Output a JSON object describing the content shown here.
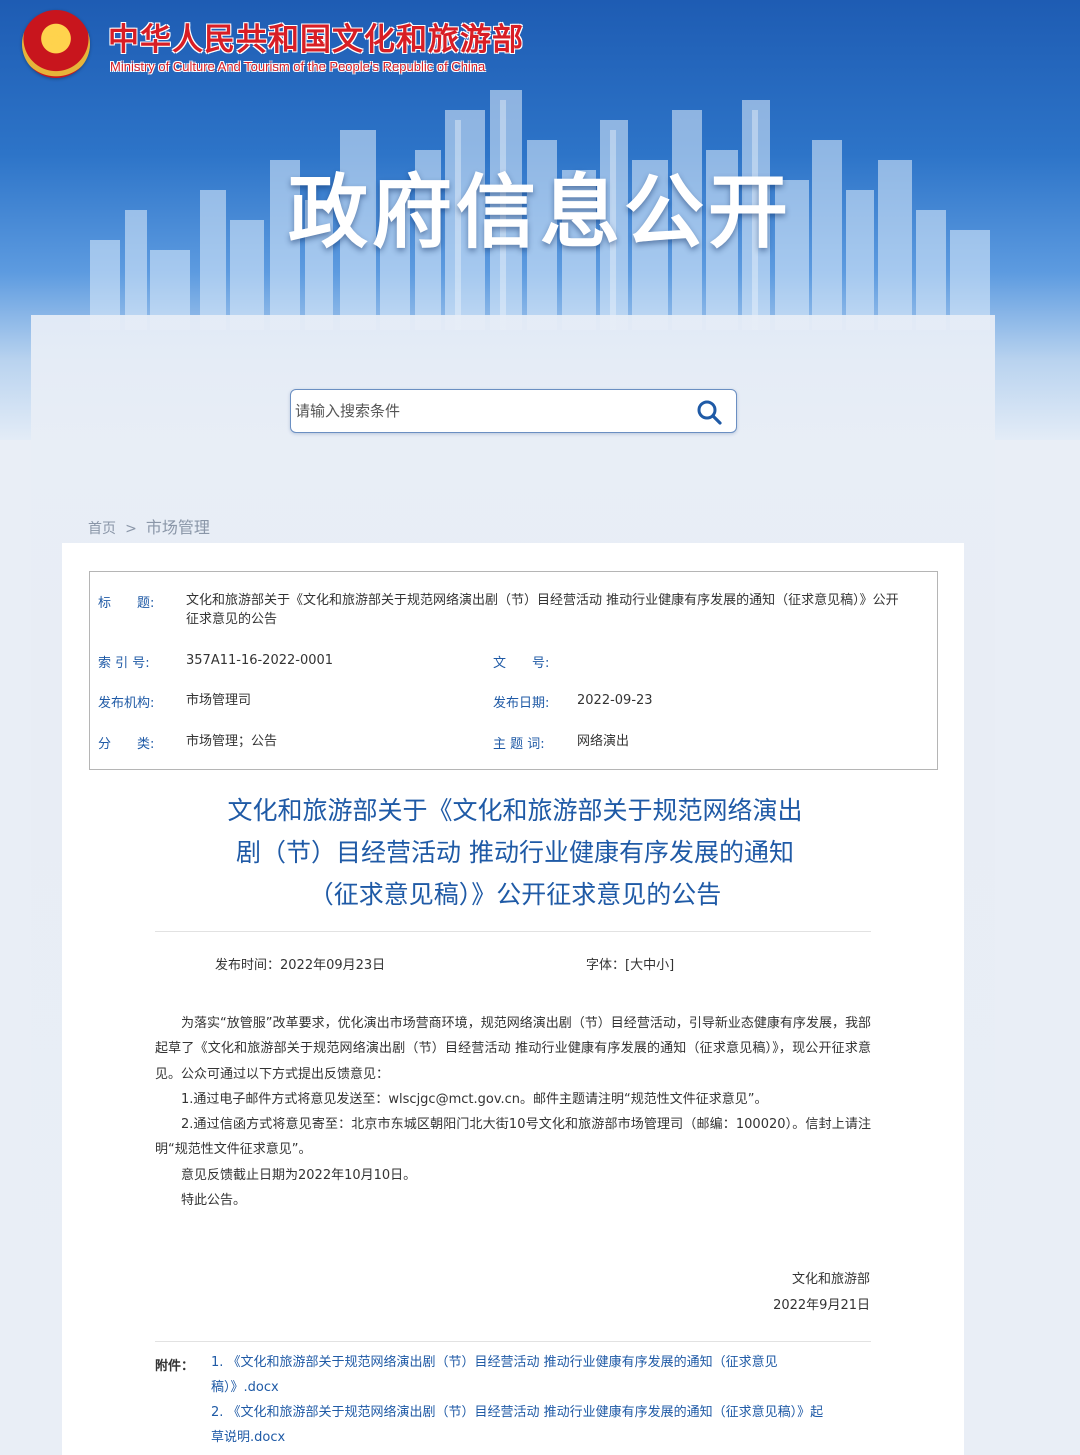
{
  "header": {
    "ministry_cn": "中华人民共和国文化和旅游部",
    "ministry_en": "Ministry of Culture And Tourism of the People’s Republic of China",
    "banner_title": "政府信息公开"
  },
  "search": {
    "placeholder": "请输入搜索条件",
    "icon": "search-icon"
  },
  "breadcrumb": {
    "home": "首页",
    "separator": ">",
    "current": "市场管理"
  },
  "meta": {
    "title_label": "标　　题:",
    "title_value": "文化和旅游部关于《文化和旅游部关于规范网络演出剧（节）目经营活动 推动行业健康有序发展的通知（征求意见稿）》公开征求意见的公告",
    "index_label": "索 引 号:",
    "index_value": "357A11-16-2022-0001",
    "docno_label": "文　　号:",
    "docno_value": "",
    "publisher_label": "发布机构:",
    "publisher_value": "市场管理司",
    "date_label": "发布日期:",
    "date_value": "2022-09-23",
    "category_label": "分　　类:",
    "category_value": "市场管理；公告",
    "topic_label": "主 题 词:",
    "topic_value": "网络演出"
  },
  "article": {
    "title_lines": [
      "文化和旅游部关于《文化和旅游部关于规范网络演出",
      "剧（节）目经营活动 推动行业健康有序发展的通知",
      "（征求意见稿）》公开征求意见的公告"
    ],
    "publish_time": "发布时间：2022年09月23日",
    "font_size": "字体：[大中小]",
    "paragraphs": [
      "为落实“放管服”改革要求，优化演出市场营商环境，规范网络演出剧（节）目经营活动，引导新业态健康有序发展，我部起草了《文化和旅游部关于规范网络演出剧（节）目经营活动 推动行业健康有序发展的通知（征求意见稿）》，现公开征求意见。公众可通过以下方式提出反馈意见：",
      "1.通过电子邮件方式将意见发送至：wlscjgc@mct.gov.cn。邮件主题请注明“规范性文件征求意见”。",
      "2.通过信函方式将意见寄至：北京市东城区朝阳门北大街10号文化和旅游部市场管理司（邮编：100020）。信封上请注明“规范性文件征求意见”。",
      "意见反馈截止日期为2022年10月10日。",
      "特此公告。"
    ],
    "sign_org": "文化和旅游部",
    "sign_date": "2022年9月21日",
    "attachments_label": "附件：",
    "attachments": [
      "1. 《文化和旅游部关于规范网络演出剧（节）目经营活动 推动行业健康有序发展的通知（征求意见稿）》.docx",
      "2. 《文化和旅游部关于规范网络演出剧（节）目经营活动 推动行业健康有序发展的通知（征求意见稿）》起草说明.docx"
    ]
  },
  "colors": {
    "accent_blue": "#1f5aa6",
    "ministry_red": "#d81e25",
    "banner_blue": "#1e5cb3"
  }
}
